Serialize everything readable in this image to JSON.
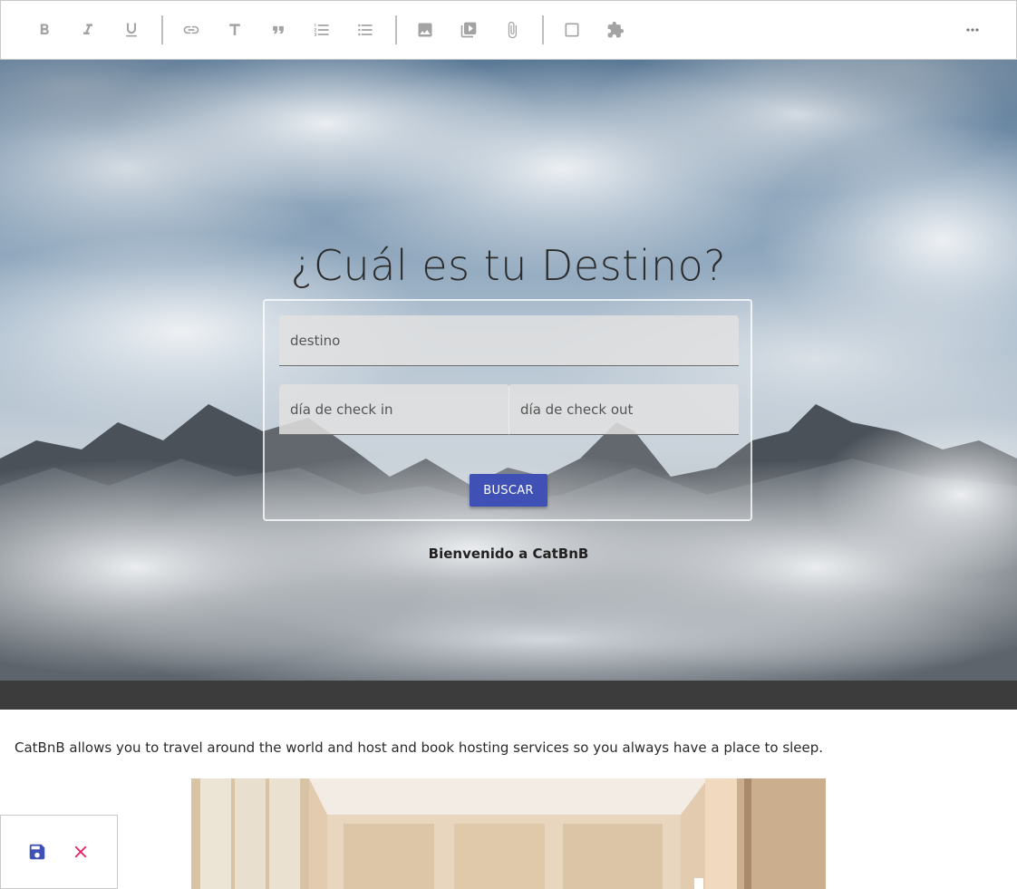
{
  "toolbar": {
    "buttons": [
      {
        "name": "bold-button",
        "icon": "bold-icon"
      },
      {
        "name": "italic-button",
        "icon": "italic-icon"
      },
      {
        "name": "underline-button",
        "icon": "underline-icon"
      },
      {
        "name": "link-button",
        "icon": "link-icon"
      },
      {
        "name": "text-style-button",
        "icon": "text-icon"
      },
      {
        "name": "blockquote-button",
        "icon": "quote-icon"
      },
      {
        "name": "ordered-list-button",
        "icon": "ordered-list-icon"
      },
      {
        "name": "unordered-list-button",
        "icon": "unordered-list-icon"
      },
      {
        "name": "image-button",
        "icon": "image-icon"
      },
      {
        "name": "video-button",
        "icon": "video-library-icon"
      },
      {
        "name": "attachment-button",
        "icon": "paperclip-icon"
      },
      {
        "name": "block-button",
        "icon": "square-icon"
      },
      {
        "name": "plugin-button",
        "icon": "puzzle-icon"
      },
      {
        "name": "more-button",
        "icon": "more-horizontal-icon"
      }
    ],
    "icon_color": "#a3a3a3"
  },
  "hero": {
    "title": "¿Cuál es tu Destino?",
    "destination_placeholder": "destino",
    "checkin_placeholder": "día de check in",
    "checkout_placeholder": "día de check out",
    "search_button": "BUSCAR",
    "welcome_text": "Bienvenido a CatBnB"
  },
  "content": {
    "description": "CatBnB allows you to travel around the world and host and book hosting services so you always have a place to sleep."
  },
  "save_widget": {
    "save_icon": "floppy-disk-icon",
    "cancel_icon": "close-icon",
    "save_color": "#3f51b5",
    "cancel_color": "#e91e63"
  },
  "colors": {
    "accent": "#3f51b5",
    "dark_band": "#3c3c3c"
  }
}
